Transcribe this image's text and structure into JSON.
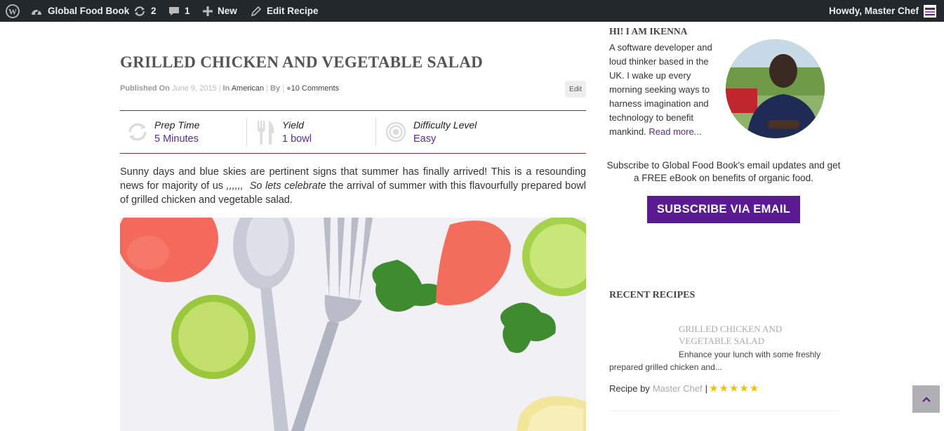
{
  "admin_bar": {
    "site_name": "Global Food Book",
    "updates_count": "2",
    "comments_count": "1",
    "new_label": "New",
    "edit_label": "Edit Recipe",
    "howdy": "Howdy, Master Chef"
  },
  "post": {
    "title": "GRILLED CHICKEN AND VEGETABLE SALAD",
    "meta": {
      "published_label": "Published On",
      "date": "June 9, 2015",
      "in_label": "In",
      "category": "American",
      "by_label": "By",
      "comments": "10 Comments"
    },
    "edit_label": "Edit",
    "info": [
      {
        "label": "Prep Time",
        "value": "5 Minutes",
        "icon": "refresh-icon"
      },
      {
        "label": "Yield",
        "value": "1 bowl",
        "icon": "fork-knife-icon"
      },
      {
        "label": "Difficulty Level",
        "value": "Easy",
        "icon": "target-icon"
      }
    ],
    "intro_1": "Sunny days and blue skies are pertinent signs  that summer has finally arrived! This is a resounding news for majority of us  ",
    "intro_marks": ",,,,,,",
    "intro_em": "So lets celebrate",
    "intro_2": " the arrival of summer with this flavourfully prepared bowl of grilled chicken and vegetable salad."
  },
  "sidebar": {
    "about_heading": "HI! I AM IKENNA",
    "bio": "A software developer and loud thinker based in the UK. I wake up every morning seeking ways to harness imagination and technology to benefit mankind. ",
    "read_more": "Read more...",
    "subscribe_text": "Subscribe to Global Food Book's email updates and get a FREE eBook on benefits of organic food.",
    "subscribe_button": "SUBSCRIBE VIA EMAIL",
    "recent_heading": "RECENT RECIPES",
    "recent": {
      "title": "GRILLED CHICKEN AND VEGETABLE SALAD",
      "excerpt": "Enhance your lunch with some freshly prepared grilled chicken and...",
      "by_label": "Recipe by",
      "author": "Master Chef",
      "rating": 5
    }
  },
  "colors": {
    "admin_bar": "#23282d",
    "accent": "#5b1a92",
    "star": "#f2c200"
  }
}
